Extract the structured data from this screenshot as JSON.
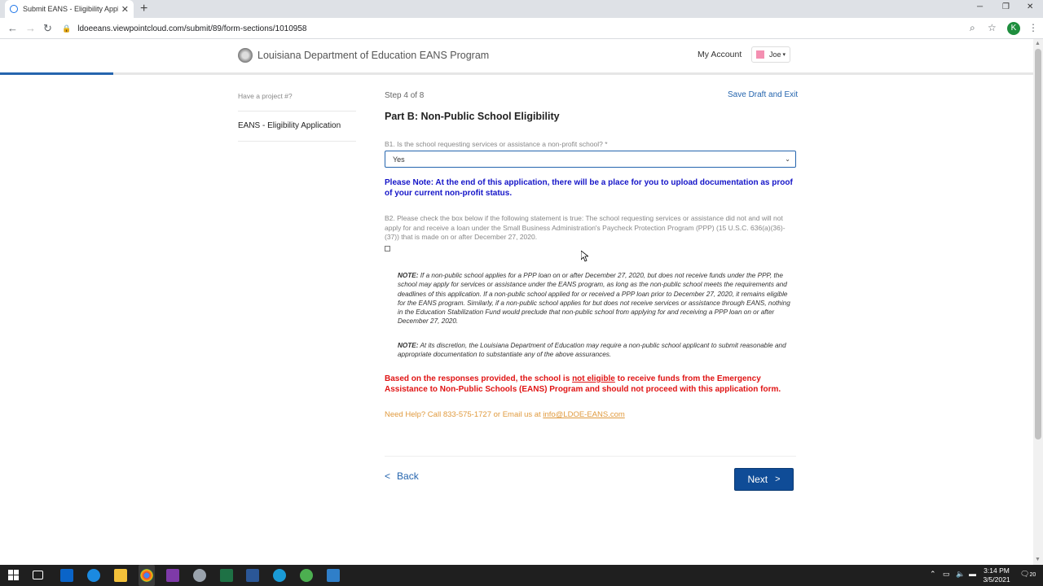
{
  "browser": {
    "tab_title": "Submit EANS - Eligibility Applica",
    "tab_close": "✕",
    "new_tab": "+",
    "url": "ldoeeans.viewpointcloud.com/submit/89/form-sections/1010958",
    "profile_initial": "K",
    "minimize": "─",
    "restore": "❐",
    "close": "✕"
  },
  "header": {
    "site_title": "Louisiana Department of Education EANS Program",
    "my_account": "My Account",
    "user_name": "Joe",
    "progress_fraction": 0.11
  },
  "sidebar": {
    "project_hint": "Have a project #?",
    "item": "EANS - Eligibility Application"
  },
  "main": {
    "step": "Step 4 of 8",
    "save_draft": "Save Draft and Exit",
    "part_title": "Part B: Non-Public School Eligibility",
    "b1_label": "B1. Is the school requesting services or assistance a non-profit school? *",
    "b1_value": "Yes",
    "blue_note": "Please Note: At the end of this application, there will be a place for you to upload documentation as proof of your current non-profit status.",
    "b2_label": "B2. Please check the box below if the following statement is true: The school requesting services or assistance did not and will not apply for and receive a loan under the Small Business Administration's Paycheck Protection Program (PPP) (15 U.S.C. 636(a)(36)-(37)) that is made on or after December 27, 2020.",
    "note1_prefix": "NOTE:",
    "note1_text": " If a non-public school applies for a PPP loan on or after December 27, 2020, but does not receive funds under the PPP, the school may apply for services or assistance under the EANS program, as long as the non-public school meets the requirements and deadlines of this application. If a non-public school applied for or received a PPP loan prior to December 27, 2020, it remains eligible for the EANS program. Similarly, if a non-public school applies for but does not receive services or assistance through EANS, nothing in the Education Stabilization Fund would preclude that non-public school from applying for and receiving a PPP loan on or after December 27, 2020.",
    "note2_prefix": "NOTE:",
    "note2_text": " At its discretion, the Louisiana Department of Education may require a non-public school applicant to submit reasonable and appropriate documentation to substantiate any of the above assurances.",
    "red_part1": "Based on the responses provided, the school is ",
    "red_underlined": "not eligible",
    "red_part2": " to receive funds from the Emergency Assistance to Non-Public Schools (EANS) Program and should not proceed with this application form.",
    "help_text": "Need Help? Call 833-575-1727 or Email us at ",
    "help_email": "info@LDOE-EANS.com",
    "back_label": "Back",
    "next_label": "Next"
  },
  "taskbar": {
    "time": "3:14 PM",
    "date": "3/5/2021",
    "notification_count": "20"
  },
  "colors": {
    "accent": "#2565ae",
    "next_button": "#0f4c97",
    "blue_note": "#1515c8",
    "error_red": "#e01414",
    "help_orange": "#e09a3e"
  }
}
